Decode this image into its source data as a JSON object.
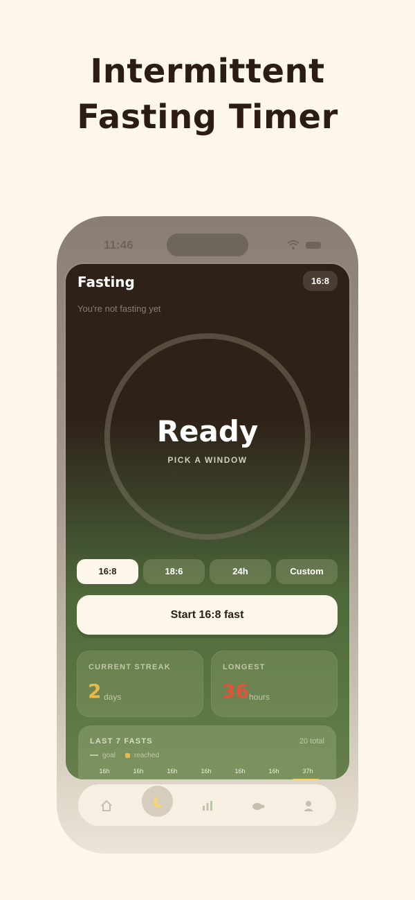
{
  "headline": {
    "line1": "Intermittent",
    "line2": "Fasting Timer"
  },
  "status_bar": {
    "time": "11:46"
  },
  "screen": {
    "title": "Fasting",
    "plan_badge": "16:8",
    "subtitle": "You're not fasting yet",
    "ring": {
      "status": "Ready",
      "sub": "PICK A WINDOW"
    },
    "windows": [
      {
        "label": "16:8",
        "active": true
      },
      {
        "label": "18:6",
        "active": false
      },
      {
        "label": "24h",
        "active": false
      },
      {
        "label": "Custom",
        "active": false
      }
    ],
    "start_button": "Start 16:8 fast",
    "stats": [
      {
        "label": "CURRENT STREAK",
        "value": "2",
        "unit": "days",
        "color": "#e9b949"
      },
      {
        "label": "LONGEST",
        "value": "36",
        "unit": "hours",
        "color": "#e2533a"
      }
    ],
    "last_fasts": {
      "title": "LAST 7 FASTS",
      "total": "20 total",
      "legend": {
        "goal": "goal",
        "reached": "reached"
      },
      "bars": [
        "16h",
        "16h",
        "16h",
        "16h",
        "16h",
        "16h",
        "37h"
      ]
    }
  },
  "tabbar": {
    "tabs": [
      {
        "icon": "home-icon"
      },
      {
        "icon": "moon-icon",
        "active": true
      },
      {
        "icon": "chart-icon"
      },
      {
        "icon": "turtle-icon"
      },
      {
        "icon": "profile-icon"
      }
    ]
  },
  "colors": {
    "background": "#fdf6ea",
    "accent_yellow": "#e9b949",
    "accent_red": "#e2533a",
    "dark": "#2b1d14"
  }
}
